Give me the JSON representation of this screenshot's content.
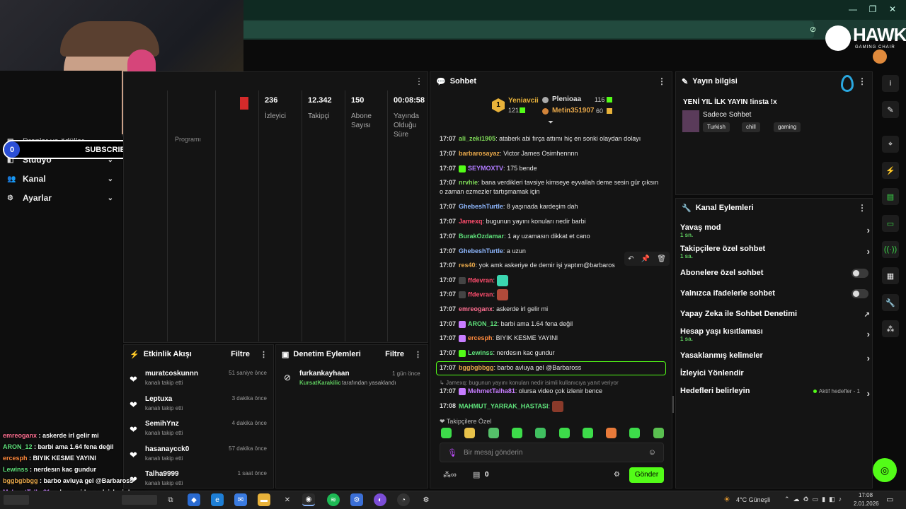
{
  "nav": {
    "items": [
      {
        "label": "Droplar ve ödüller"
      },
      {
        "label": "Stüdyo"
      },
      {
        "label": "Kanal"
      },
      {
        "label": "Ayarlar"
      }
    ],
    "programs_label": "Programı"
  },
  "subscribers_bar": {
    "left": "0",
    "label": "SUBSCRIBERS",
    "right": "10",
    "progress_fraction": 0
  },
  "stats": [
    {
      "value": "236",
      "label": "İzleyici"
    },
    {
      "value": "12.342",
      "label": "Takipçi"
    },
    {
      "value": "150",
      "label": "Abone Sayısı"
    },
    {
      "value": "00:08:58",
      "label": "Yayında Olduğu Süre"
    }
  ],
  "chat": {
    "title": "Sohbet",
    "top_gifters": [
      {
        "rank": "1",
        "name": "Yeniavcii",
        "count": "121"
      },
      {
        "name": "Plenioaa",
        "count": "116"
      },
      {
        "name": "Metin351907",
        "count": "60"
      }
    ],
    "messages": [
      {
        "time": "17:07",
        "user": "ali_zeki1905",
        "color": "#7ed957",
        "text": "ataberk abi fırça attımı hiç en sonki olaydan dolayı"
      },
      {
        "time": "17:07",
        "user": "barbarosayaz",
        "color": "#e8a84a",
        "text": "Victor James Osimhennnn"
      },
      {
        "time": "17:07",
        "user": "SEYMOXTV",
        "color": "#b07bff",
        "text": "175 bende"
      },
      {
        "time": "17:07",
        "user": "nrvhie",
        "color": "#7ed957",
        "text": "bana verdikleri tavsiye kimseye eyvallah deme sesin gür çıksın o zaman ezmezler tartışmamak için"
      },
      {
        "time": "17:07",
        "user": "GhebeshTurtle",
        "color": "#8fb8ff",
        "text": "8 yaşınada kardeşim dah"
      },
      {
        "time": "17:07",
        "user": "Jamexq",
        "color": "#ff4d6d",
        "text": "bugunun yayını konuları nedir barbi"
      },
      {
        "time": "17:07",
        "user": "BurakOzdamar",
        "color": "#5ee07a",
        "text": "1 ay uzamasın dikkat et cano"
      },
      {
        "time": "17:07",
        "user": "GhebeshTurtle",
        "color": "#8fb8ff",
        "text": "a uzun"
      },
      {
        "time": "17:07",
        "user": "res40",
        "color": "#e8a84a",
        "text": "yok amk askeriye de demir işi yaptım@barbaros"
      },
      {
        "time": "17:07",
        "user": "ffdevran",
        "color": "#ff4d6d",
        "text": ""
      },
      {
        "time": "17:07",
        "user": "ffdevran",
        "color": "#ff4d6d",
        "text": ""
      },
      {
        "time": "17:07",
        "user": "emreoganx",
        "color": "#ff6f91",
        "text": "askerde irl gelir mi"
      },
      {
        "time": "17:07",
        "user": "ARON_12",
        "color": "#5ee07a",
        "text": "barbi ama 1.64 fena değil"
      },
      {
        "time": "17:07",
        "user": "ercesph",
        "color": "#ff8a3d",
        "text": "BIYIK KESME YAYINI"
      },
      {
        "time": "17:07",
        "user": "Lewinss",
        "color": "#5ee07a",
        "text": "nerdesın kac gundur"
      },
      {
        "time": "17:07",
        "user": "bggbgbbgg",
        "color": "#e8a84a",
        "text": "barbo avluya gel @Barbaross"
      },
      {
        "time": "",
        "user": "",
        "color": "#888888",
        "text": "Jamexq: bugunun yayını konuları nedir isimli kullanıcıya yanıt veriyor"
      },
      {
        "time": "17:07",
        "user": "MehmetTalha81",
        "color": "#c77dff",
        "text": "olursa video çok izlenir bence"
      },
      {
        "time": "17:08",
        "user": "MAHMUT_YARRAK_HASTASI",
        "color": "#5ee07a",
        "text": ""
      }
    ],
    "followers_only_label": "Takipçilere Özel",
    "input_placeholder": "Bir mesaj gönderin",
    "points": "0",
    "send_label": "Gönder"
  },
  "stream_info": {
    "title": "Yayın bilgisi",
    "stream_title": "YENİ YIL İLK YAYIN !insta !x",
    "category": "Sadece Sohbet",
    "tags": [
      "Turkish",
      "chill",
      "gaming"
    ]
  },
  "channel_actions": {
    "title": "Kanal Eylemleri",
    "items": [
      {
        "label": "Yavaş mod",
        "sub": "1 sn."
      },
      {
        "label": "Takipçilere özel sohbet",
        "sub": "1 sa."
      },
      {
        "label": "Abonelere özel sohbet",
        "sub": ""
      },
      {
        "label": "Yalnızca ifadelerle sohbet",
        "sub": ""
      },
      {
        "label": "Yapay Zeka ile Sohbet Denetimi",
        "sub": ""
      },
      {
        "label": "Hesap yaşı kısıtlaması",
        "sub": "1 sa."
      },
      {
        "label": "Yasaklanmış kelimeler",
        "sub": ""
      },
      {
        "label": "İzleyici Yönlendir",
        "sub": ""
      },
      {
        "label": "Hedefleri belirleyin",
        "sub": "",
        "extra": "Aktif hedefler - 1"
      }
    ]
  },
  "activity": {
    "title": "Etkinlik Akışı",
    "filter_label": "Filtre",
    "events": [
      {
        "name": "muratcoskunnn",
        "action": "kanalı takip etti",
        "time": "51 saniye önce"
      },
      {
        "name": "Leptuxa",
        "action": "kanalı takip etti",
        "time": "3 dakika önce"
      },
      {
        "name": "SemihYnz",
        "action": "kanalı takip etti",
        "time": "4 dakika önce"
      },
      {
        "name": "hasanaycck0",
        "action": "kanalı takip etti",
        "time": "57 dakika önce"
      },
      {
        "name": "Talha9999",
        "action": "kanalı takip etti",
        "time": "1 saat önce"
      }
    ]
  },
  "moderation": {
    "title": "Denetim Eylemleri",
    "filter_label": "Filtre",
    "entries": [
      {
        "name": "furkankayhaan",
        "by": "KursatKarakilic",
        "action": "tarafından yasaklandı",
        "time": "1 gün önce"
      }
    ]
  },
  "overlay_chat": [
    {
      "user": "emreoganx",
      "color": "#ff6f91",
      "text": "askerde irl gelir mi"
    },
    {
      "user": "ARON_12",
      "color": "#5ee07a",
      "text": "barbi ama 1.64 fena değil"
    },
    {
      "user": "ercesph",
      "color": "#ff8a3d",
      "text": "BIYIK KESME YAYINI"
    },
    {
      "user": "Lewinss",
      "color": "#5ee07a",
      "text": "nerdesın kac gundur"
    },
    {
      "user": "bggbgbbgg",
      "color": "#e8a84a",
      "text": "barbo avluya gel @Barbaross"
    },
    {
      "user": "MehmetTalha81",
      "color": "#c77dff",
      "text": "olursa video çok izlenir bence"
    },
    {
      "user": "MAHMUT_YARRAK_HASTASI",
      "color": "#5ee07a",
      "text": ""
    }
  ],
  "brand": {
    "logo_text": "HAWK",
    "logo_sub": "GAMING CHAIR"
  },
  "taskbar": {
    "weather": "4°C  Güneşli",
    "time": "17:08",
    "date": "2.01.2026"
  },
  "colors": {
    "accent": "#53fc18",
    "panel": "#141414",
    "bg": "#0b0b0b"
  }
}
